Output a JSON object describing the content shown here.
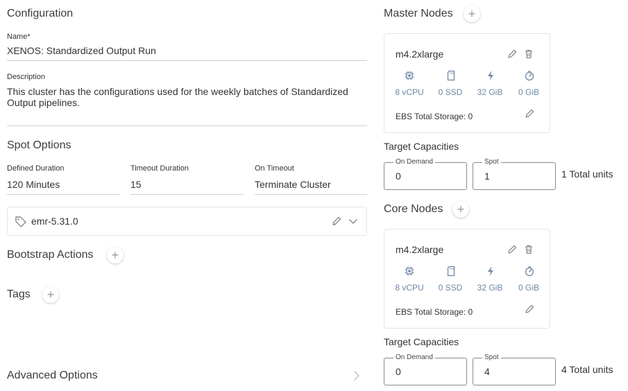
{
  "configuration": {
    "title": "Configuration",
    "name_label": "Name*",
    "name_value": "XENOS: Standardized Output Run",
    "description_label": "Description",
    "description_value": "This cluster has the configurations used for the weekly batches of Standardized Output pipelines."
  },
  "spot_options": {
    "title": "Spot Options",
    "defined_duration_label": "Defined Duration",
    "defined_duration_value": "120 Minutes",
    "timeout_duration_label": "Timeout Duration",
    "timeout_duration_value": "15",
    "on_timeout_label": "On Timeout",
    "on_timeout_value": "Terminate Cluster"
  },
  "release": {
    "label": "emr-5.31.0"
  },
  "bootstrap": {
    "title": "Bootstrap Actions"
  },
  "tags": {
    "title": "Tags"
  },
  "advanced": {
    "title": "Advanced Options"
  },
  "master_nodes": {
    "title": "Master Nodes",
    "instance": "m4.2xlarge",
    "specs": {
      "vcpu": "8 vCPU",
      "ssd": "0 SSD",
      "memory": "32 GiB",
      "gpu": "0 GiB"
    },
    "ebs": "EBS Total Storage: 0",
    "target_title": "Target Capacities",
    "on_demand_label": "On Demand",
    "on_demand_value": "0",
    "spot_label": "Spot",
    "spot_value": "1",
    "total": "1 Total units"
  },
  "core_nodes": {
    "title": "Core Nodes",
    "instance": "m4.2xlarge",
    "specs": {
      "vcpu": "8 vCPU",
      "ssd": "0 SSD",
      "memory": "32 GiB",
      "gpu": "0 GiB"
    },
    "ebs": "EBS Total Storage: 0",
    "target_title": "Target Capacities",
    "on_demand_label": "On Demand",
    "on_demand_value": "0",
    "spot_label": "Spot",
    "spot_value": "4",
    "total": "4 Total units"
  },
  "icons": {
    "plus": "+",
    "edit": "pencil-icon",
    "delete": "trash-icon",
    "cpu": "cpu-icon",
    "ssd": "sd-card-icon",
    "memory": "lightning-icon",
    "gpu": "gauge-icon",
    "tag": "tag-icon",
    "chevron": "chevron-icon"
  },
  "colors": {
    "spec_text": "#6f87a6",
    "icon": "#8a8a8a",
    "border": "#cfcfcf"
  }
}
